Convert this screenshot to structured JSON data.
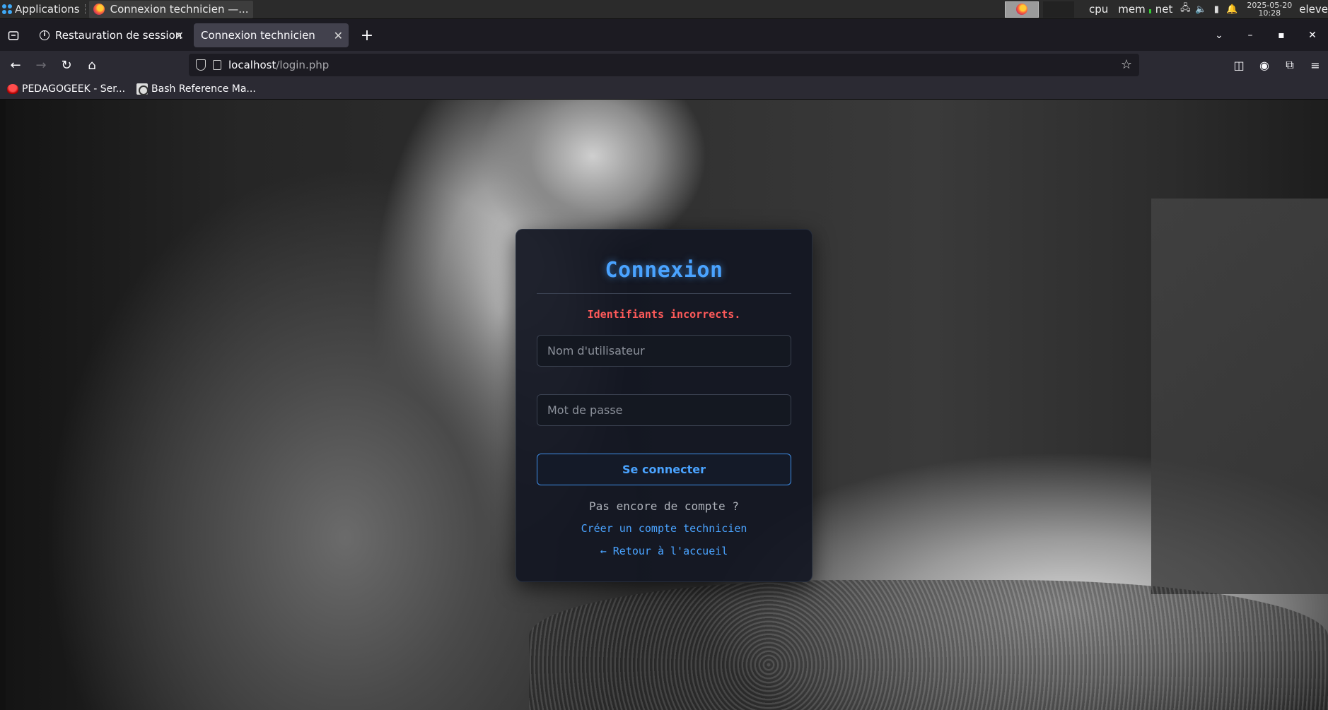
{
  "panel": {
    "apps_label": "Applications",
    "task_title": "Connexion technicien —...",
    "monitors": [
      "cpu",
      "mem",
      "net"
    ],
    "date": "2025-05-20",
    "time": "10:28",
    "user": "eleve"
  },
  "browser": {
    "tabs": [
      {
        "label": "Restauration de session",
        "active": false
      },
      {
        "label": "Connexion technicien",
        "active": true
      }
    ],
    "url_host": "localhost",
    "url_path": "/login.php",
    "bookmarks": [
      {
        "label": "PEDAGOGEEK - Ser..."
      },
      {
        "label": "Bash Reference Ma..."
      }
    ]
  },
  "login": {
    "title": "Connexion",
    "error": "Identifiants incorrects.",
    "username_placeholder": "Nom d'utilisateur",
    "password_placeholder": "Mot de passe",
    "submit_label": "Se connecter",
    "no_account": "Pas encore de compte ?",
    "create_account": "Créer un compte technicien",
    "back_home": "← Retour à l'accueil"
  },
  "colors": {
    "accent": "#4aa3ff",
    "error": "#ff5a5a",
    "card_bg": "#121622"
  }
}
